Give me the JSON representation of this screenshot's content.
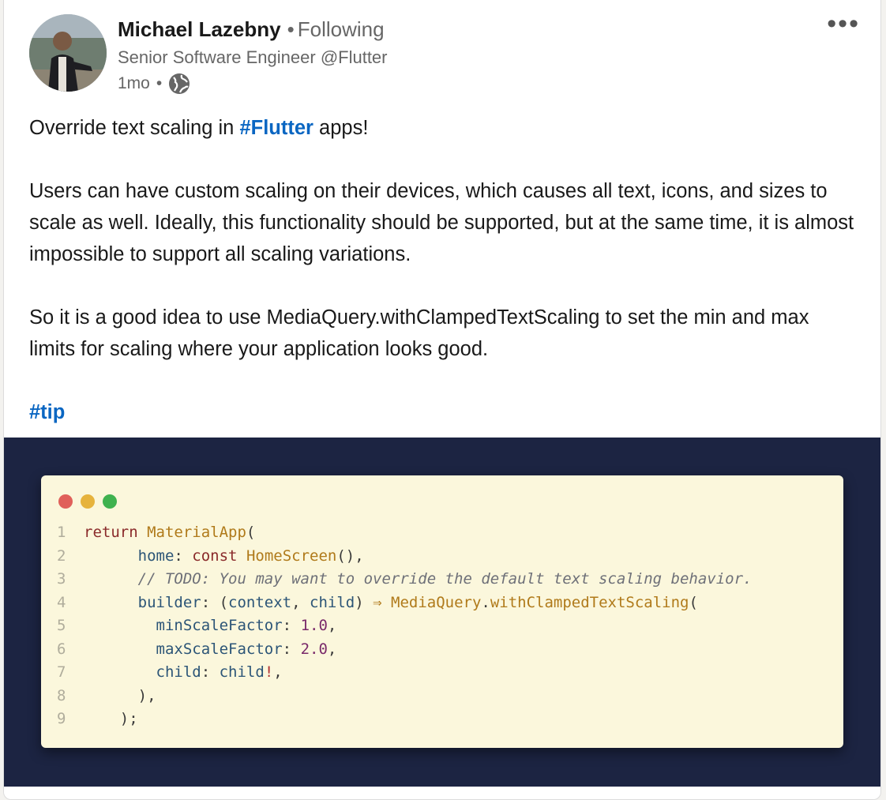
{
  "post": {
    "author_name": "Michael Lazebny",
    "separator": "•",
    "following_label": "Following",
    "headline": "Senior Software Engineer @Flutter",
    "time": "1mo",
    "meta_separator": "•",
    "visibility_icon": "globe-icon",
    "more_icon": "more-horizontal-icon",
    "more_label": "•••"
  },
  "body": {
    "p1_before": "Override text scaling in ",
    "p1_hashtag": "#Flutter",
    "p1_after": " apps!",
    "p2": "Users can have custom scaling on their devices, which causes all text, icons, and sizes to scale as well. Ideally, this functionality should be supported, but at the same time, it is almost impossible to support all scaling variations.",
    "p3": "So it is a good idea to use MediaQuery.withClampedTextScaling to set the min and max limits for scaling where your application looks good.",
    "p4_hashtag": "#tip"
  },
  "code_image": {
    "lines": [
      {
        "n": "1",
        "indent": "",
        "tokens": [
          {
            "t": "return ",
            "c": "kw"
          },
          {
            "t": "MaterialApp",
            "c": "fn"
          },
          {
            "t": "(",
            "c": "pu"
          }
        ]
      },
      {
        "n": "2",
        "indent": "      ",
        "tokens": [
          {
            "t": "home",
            "c": "pr"
          },
          {
            "t": ": ",
            "c": "pu"
          },
          {
            "t": "const ",
            "c": "kw"
          },
          {
            "t": "HomeScreen",
            "c": "fn"
          },
          {
            "t": "(),",
            "c": "pu"
          }
        ]
      },
      {
        "n": "3",
        "indent": "      ",
        "tokens": [
          {
            "t": "// TODO: You may want to override the default text scaling behavior.",
            "c": "cm"
          }
        ]
      },
      {
        "n": "4",
        "indent": "      ",
        "tokens": [
          {
            "t": "builder",
            "c": "pr"
          },
          {
            "t": ": (",
            "c": "pu"
          },
          {
            "t": "context",
            "c": "pr"
          },
          {
            "t": ", ",
            "c": "pu"
          },
          {
            "t": "child",
            "c": "pr"
          },
          {
            "t": ") ",
            "c": "pu"
          },
          {
            "t": "⇒ ",
            "c": "fn"
          },
          {
            "t": "MediaQuery",
            "c": "fn"
          },
          {
            "t": ".",
            "c": "pu"
          },
          {
            "t": "withClampedTextScaling",
            "c": "fn"
          },
          {
            "t": "(",
            "c": "pu"
          }
        ]
      },
      {
        "n": "5",
        "indent": "        ",
        "tokens": [
          {
            "t": "minScaleFactor",
            "c": "pr"
          },
          {
            "t": ": ",
            "c": "pu"
          },
          {
            "t": "1.0",
            "c": "num"
          },
          {
            "t": ",",
            "c": "pu"
          }
        ]
      },
      {
        "n": "6",
        "indent": "        ",
        "tokens": [
          {
            "t": "maxScaleFactor",
            "c": "pr"
          },
          {
            "t": ": ",
            "c": "pu"
          },
          {
            "t": "2.0",
            "c": "num"
          },
          {
            "t": ",",
            "c": "pu"
          }
        ]
      },
      {
        "n": "7",
        "indent": "        ",
        "tokens": [
          {
            "t": "child",
            "c": "pr"
          },
          {
            "t": ": ",
            "c": "pu"
          },
          {
            "t": "child",
            "c": "pr"
          },
          {
            "t": "!",
            "c": "op"
          },
          {
            "t": ",",
            "c": "pu"
          }
        ]
      },
      {
        "n": "8",
        "indent": "      ",
        "tokens": [
          {
            "t": "),",
            "c": "pu"
          }
        ]
      },
      {
        "n": "9",
        "indent": "    ",
        "tokens": [
          {
            "t": ");",
            "c": "pu"
          }
        ]
      }
    ]
  },
  "colors": {
    "hashtag": "#0a66c2",
    "media_bg": "#1c2442",
    "code_bg": "#fbf7dc",
    "traffic_red": "#e0605a",
    "traffic_yellow": "#e6b33d",
    "traffic_green": "#3fb24f"
  }
}
